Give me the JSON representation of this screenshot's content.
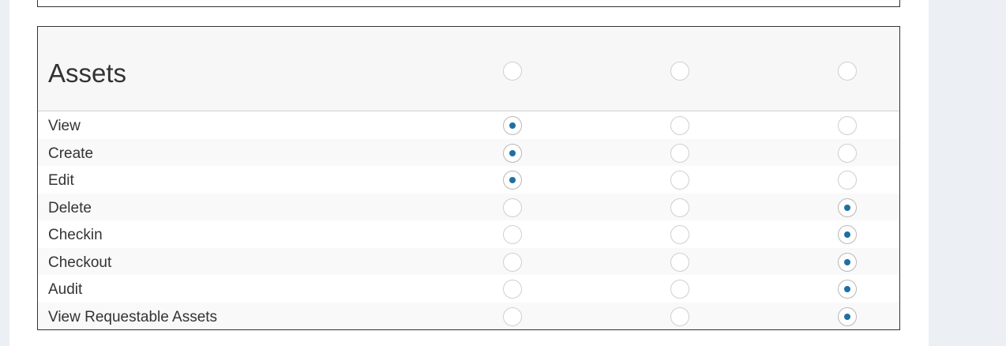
{
  "section": {
    "title": "Assets",
    "header_radios": [
      false,
      false,
      false
    ]
  },
  "permissions": [
    {
      "label": "View",
      "selected": 0
    },
    {
      "label": "Create",
      "selected": 0
    },
    {
      "label": "Edit",
      "selected": 0
    },
    {
      "label": "Delete",
      "selected": 2
    },
    {
      "label": "Checkin",
      "selected": 2
    },
    {
      "label": "Checkout",
      "selected": 2
    },
    {
      "label": "Audit",
      "selected": 2
    },
    {
      "label": "View Requestable Assets",
      "selected": 2
    }
  ]
}
